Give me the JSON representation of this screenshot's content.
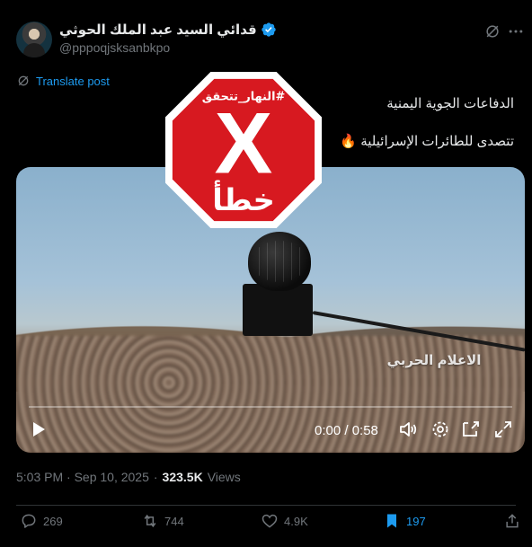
{
  "post": {
    "author": {
      "display_name": "قدائي السيد عبد الملك الحوثي",
      "handle": "@pppoqjsksanbkpo"
    },
    "translate_label": "Translate post",
    "text_lines": [
      "الدفاعات الجوية اليمنية",
      "تتصدى للطائرات الإسرائيلية 🔥"
    ],
    "video": {
      "watermark": "الاعلام الحربي",
      "time": "0:00 / 0:58",
      "progress": 0.0
    },
    "timestamp": "5:03 PM · Sep 10, 2025",
    "separator": "·",
    "views": {
      "count": "323.5K",
      "label": "Views"
    },
    "actions": {
      "replies": "269",
      "reposts": "744",
      "likes": "4.9K",
      "bookmarks": "197"
    }
  },
  "overlay": {
    "hashtag": "#النهار_تتحقق",
    "mark": "X",
    "verdict": "خطأ"
  },
  "colors": {
    "accent": "#1d9bf0",
    "muted": "#71767b",
    "stop_sign_red": "#d71920"
  }
}
